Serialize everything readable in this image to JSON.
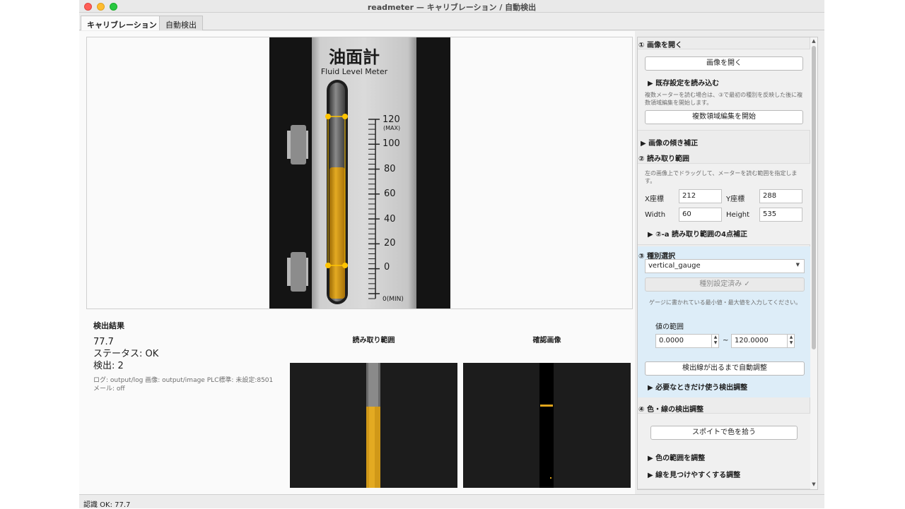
{
  "window": {
    "title": "readmeter — キャリブレーション / 自動検出"
  },
  "tabs": [
    {
      "label": "キャリブレーション"
    },
    {
      "label": "自動検出"
    }
  ],
  "meter_image": {
    "title_jp": "油面計",
    "title_en": "Fluid Level Meter",
    "scale_labels": [
      "120",
      "(MAX)",
      "100",
      "80",
      "60",
      "40",
      "20",
      "0",
      "0(MIN)"
    ]
  },
  "result": {
    "title": "検出結果",
    "value": "77.7",
    "status": "ステータス: OK",
    "detected": "検出: 2",
    "log_line": "ログ: output/log  画像: output/image  PLC標準: 未設定:8501",
    "mail_line": "メール: off"
  },
  "crops": {
    "read_range_title": "読み取り範囲",
    "confirm_title": "確認画像"
  },
  "panel": {
    "s1_title": "① 画像を開く",
    "open_button": "画像を開く",
    "load_settings": "▶ 既存設定を読み込む",
    "multi_note": "複数メーターを読む場合は、③で最初の種別を反映した後に複数領域編集を開始します。",
    "multi_button": "複数領域編集を開始",
    "tilt": "▶ 画像の傾き補正",
    "s2_title": "② 読み取り範囲",
    "s2_note": "左の画像上でドラッグして、メーターを読む範囲を指定します。",
    "x_label": "X座標",
    "x_value": "212",
    "y_label": "Y座標",
    "y_value": "288",
    "w_label": "Width",
    "w_value": "60",
    "h_label": "Height",
    "h_value": "535",
    "four_point": "▶ ②-a 読み取り範囲の4点補正",
    "s3_title": "③ 種別選択",
    "type_value": "vertical_gauge",
    "type_set_button": "種別設定済み ✓",
    "range_note": "ゲージに書かれている最小値・最大値を入力してください。",
    "range_label": "値の範囲",
    "min_value": "0.0000",
    "range_sep": "~",
    "max_value": "120.0000",
    "auto_adjust_button": "検出線が出るまで自動調整",
    "optional_adjust": "▶ 必要なときだけ使う検出調整",
    "s4_title": "④ 色・線の検出調整",
    "eyedropper_button": "スポイトで色を拾う",
    "color_range": "▶ 色の範囲を調整",
    "line_adjust": "▶ 線を見つけやすくする調整"
  },
  "statusbar": {
    "text": "認識 OK: 77.7"
  },
  "colors": {
    "oil": "#e0a51c",
    "handle": "#ffc400",
    "panel_blue": "#ddedf8"
  }
}
